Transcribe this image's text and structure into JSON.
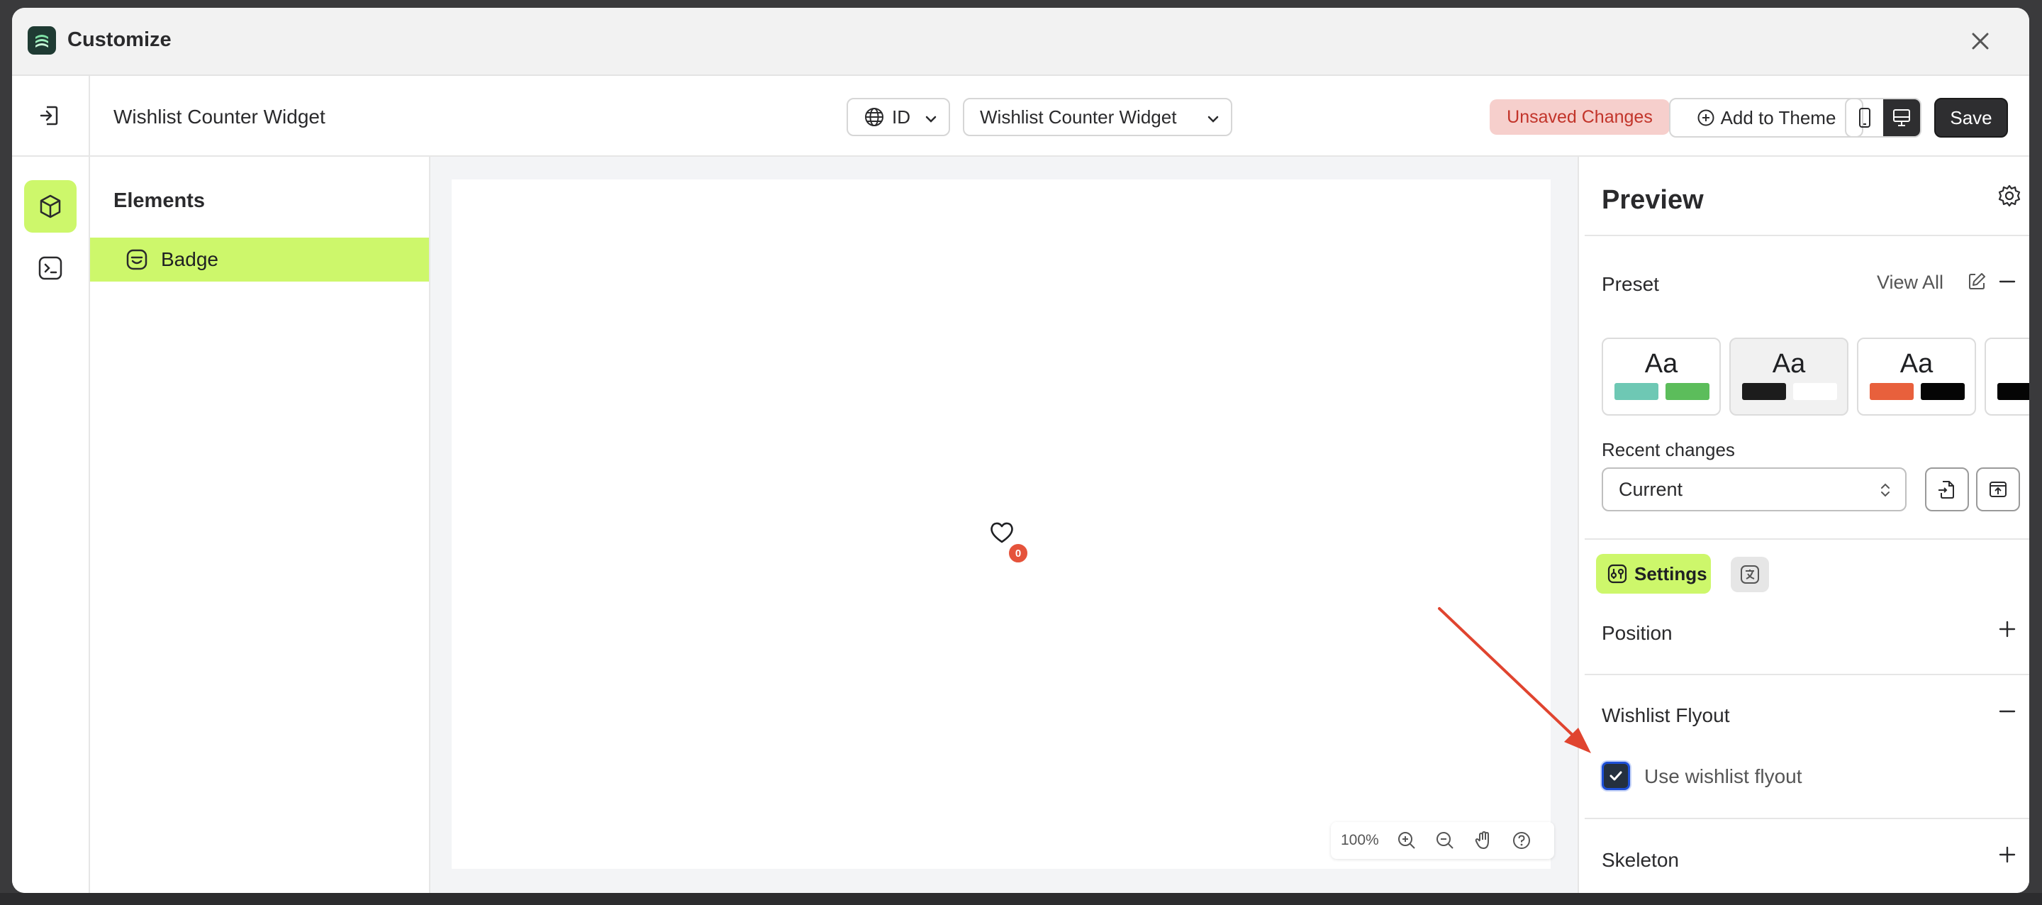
{
  "window": {
    "title": "Customize",
    "close_icon": "close-icon"
  },
  "toolbar": {
    "page_title": "Wishlist Counter Widget",
    "language": "ID",
    "widget_select": "Wishlist Counter Widget",
    "unsaved_label": "Unsaved Changes",
    "add_to_theme_label": "Add to Theme",
    "save_label": "Save"
  },
  "elements_panel": {
    "title": "Elements",
    "items": [
      {
        "label": "Badge",
        "selected": true
      }
    ]
  },
  "canvas": {
    "badge_count": "0",
    "zoom": "100%"
  },
  "preview": {
    "title": "Preview",
    "preset": {
      "title": "Preset",
      "view_all": "View All",
      "cards": [
        {
          "label": "Aa",
          "colors": [
            "#6ec8b4",
            "#5cbd5b"
          ]
        },
        {
          "label": "Aa",
          "colors": [
            "#1c1c1c",
            "#ffffff"
          ]
        },
        {
          "label": "Aa",
          "colors": [
            "#e8603c",
            "#050505"
          ]
        },
        {
          "label": "",
          "colors": [
            "#050505"
          ]
        }
      ]
    },
    "recent_changes": {
      "label": "Recent changes",
      "value": "Current"
    },
    "tabs": {
      "settings_label": "Settings"
    },
    "sections": {
      "position": "Position",
      "wishlist_flyout": "Wishlist Flyout",
      "use_wishlist_flyout": "Use wishlist flyout",
      "skeleton": "Skeleton"
    }
  },
  "colors": {
    "accent": "#cdf76b",
    "unsaved_bg": "#f6cfcc",
    "unsaved_text": "#c2342a",
    "badge": "#e5533b",
    "annotation_arrow": "#e0442f"
  }
}
